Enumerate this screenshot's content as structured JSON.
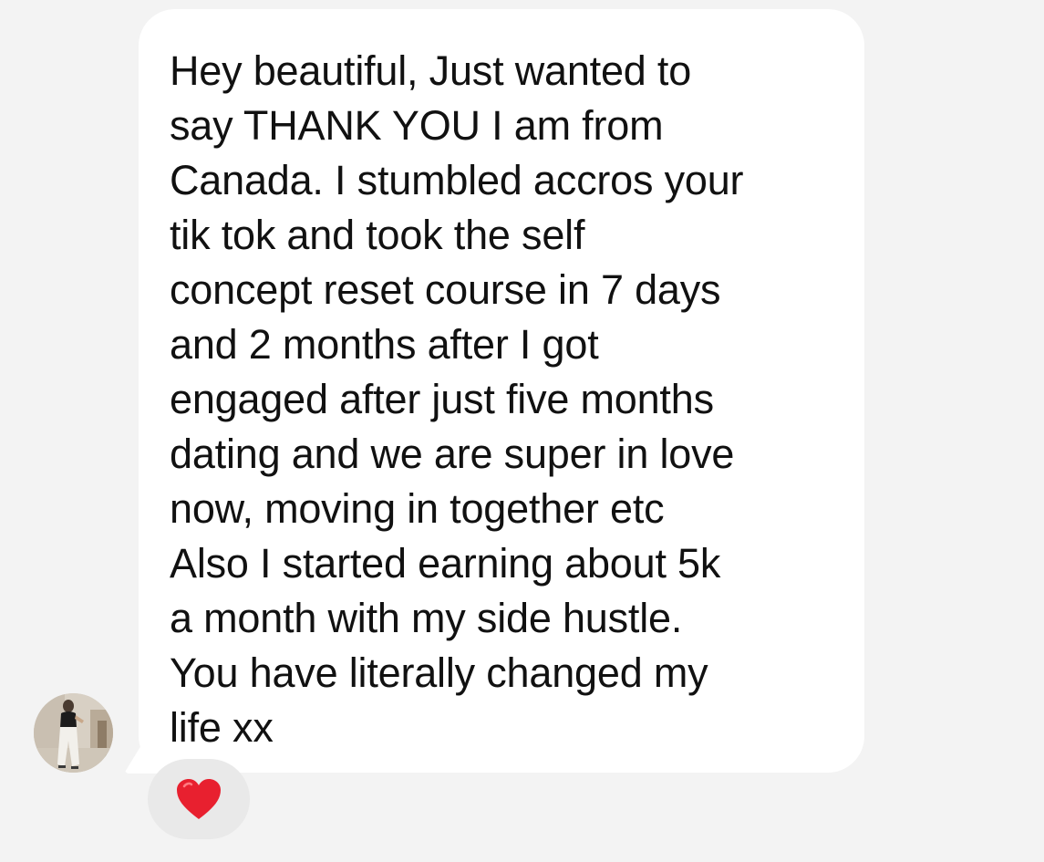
{
  "message": {
    "lines": [
      "Hey beautiful, Just wanted to",
      "say THANK YOU I am from",
      "Canada. I stumbled accros your",
      "tik tok and took the self",
      "concept reset course in 7 days",
      "and 2 months after I got",
      "engaged after just five months",
      "dating and we are super in love",
      "now, moving in together etc",
      "Also I started earning about 5k",
      "a month with my side hustle.",
      "You have literally changed my",
      "life xx"
    ]
  },
  "avatar": {
    "icon": "user-avatar-photo"
  },
  "reaction": {
    "icon": "red-heart-icon",
    "color": "#e8202f"
  },
  "colors": {
    "background": "#f3f3f3",
    "bubble": "#ffffff",
    "text": "#111111",
    "reaction_pill": "#e9e9e9"
  }
}
